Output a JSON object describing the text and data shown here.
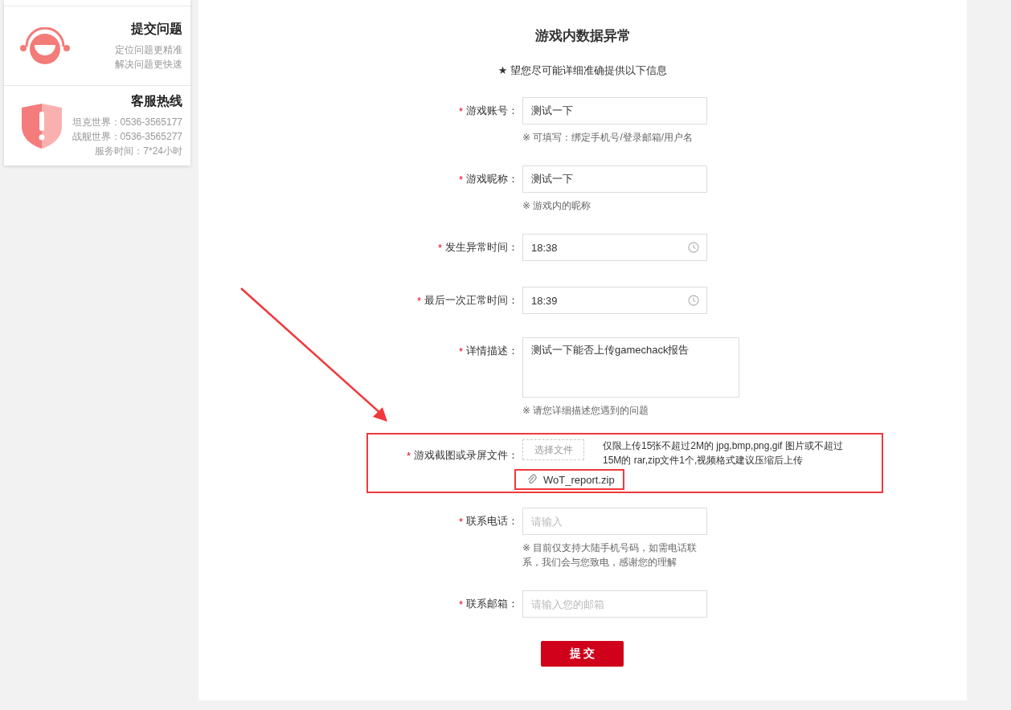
{
  "sidebar": {
    "cards": [
      {
        "kind": "submit",
        "title": "提交问题",
        "lines": [
          "定位问题更精准",
          "解决问题更快速"
        ]
      },
      {
        "kind": "hotline",
        "title": "客服热线",
        "lines": [
          "坦克世界：0536-3565177",
          "战舰世界：0536-3565277",
          "服务时间：7*24小时"
        ]
      }
    ]
  },
  "form": {
    "title": "游戏内数据异常",
    "notice": "★ 望您尽可能详细准确提供以下信息",
    "fields": [
      {
        "kind": "text",
        "label": "游戏账号：",
        "required_mark": "*",
        "value": "测试一下",
        "hint": "※ 可填写：绑定手机号/登录邮箱/用户名"
      },
      {
        "kind": "text",
        "label": "游戏昵称：",
        "required_mark": "*",
        "value": "测试一下",
        "hint": "※ 游戏内的昵称"
      },
      {
        "kind": "time",
        "label": "发生异常时间：",
        "required_mark": "*",
        "value": "18:38"
      },
      {
        "kind": "time",
        "label": "最后一次正常时间：",
        "required_mark": "*",
        "value": "18:39"
      },
      {
        "kind": "textarea",
        "label": "详情描述：",
        "required_mark": "*",
        "value": "测试一下能否上传gamechack报告",
        "hint": "※ 请您详细描述您遇到的问题"
      },
      {
        "kind": "upload",
        "label": "游戏截图或录屏文件：",
        "required_mark": "*",
        "button": "选择文件",
        "note": "仅限上传15张不超过2M的 jpg,bmp,png,gif 图片或不超过15M的 rar,zip文件1个,视频格式建议压缩后上传",
        "file": {
          "name": "WoT_report.zip",
          "highlighted": true
        },
        "highlighted": true
      },
      {
        "kind": "text",
        "label": "联系电话：",
        "required_mark": "*",
        "placeholder": "请输入",
        "hint": "※ 目前仅支持大陆手机号码，如需电话联系，我们会与您致电，感谢您的理解"
      },
      {
        "kind": "text",
        "label": "联系邮箱：",
        "required_mark": "*",
        "placeholder": "请输入您的邮箱"
      }
    ],
    "submit": "提 交"
  }
}
